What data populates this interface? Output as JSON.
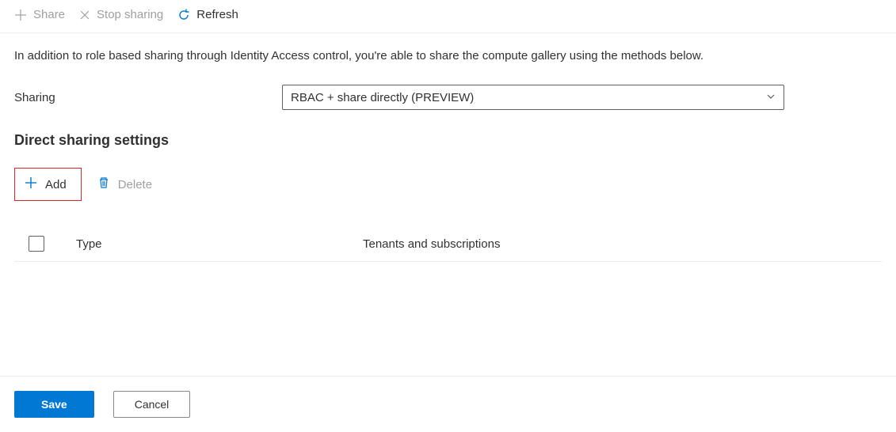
{
  "toolbar": {
    "share_label": "Share",
    "stop_sharing_label": "Stop sharing",
    "refresh_label": "Refresh"
  },
  "description": "In addition to role based sharing through Identity Access control, you're able to share the compute gallery using the methods below.",
  "form": {
    "sharing_label": "Sharing",
    "sharing_value": "RBAC + share directly (PREVIEW)"
  },
  "section_title": "Direct sharing settings",
  "actions": {
    "add_label": "Add",
    "delete_label": "Delete"
  },
  "table": {
    "col_type": "Type",
    "col_tenants": "Tenants and subscriptions"
  },
  "footer": {
    "save_label": "Save",
    "cancel_label": "Cancel"
  }
}
